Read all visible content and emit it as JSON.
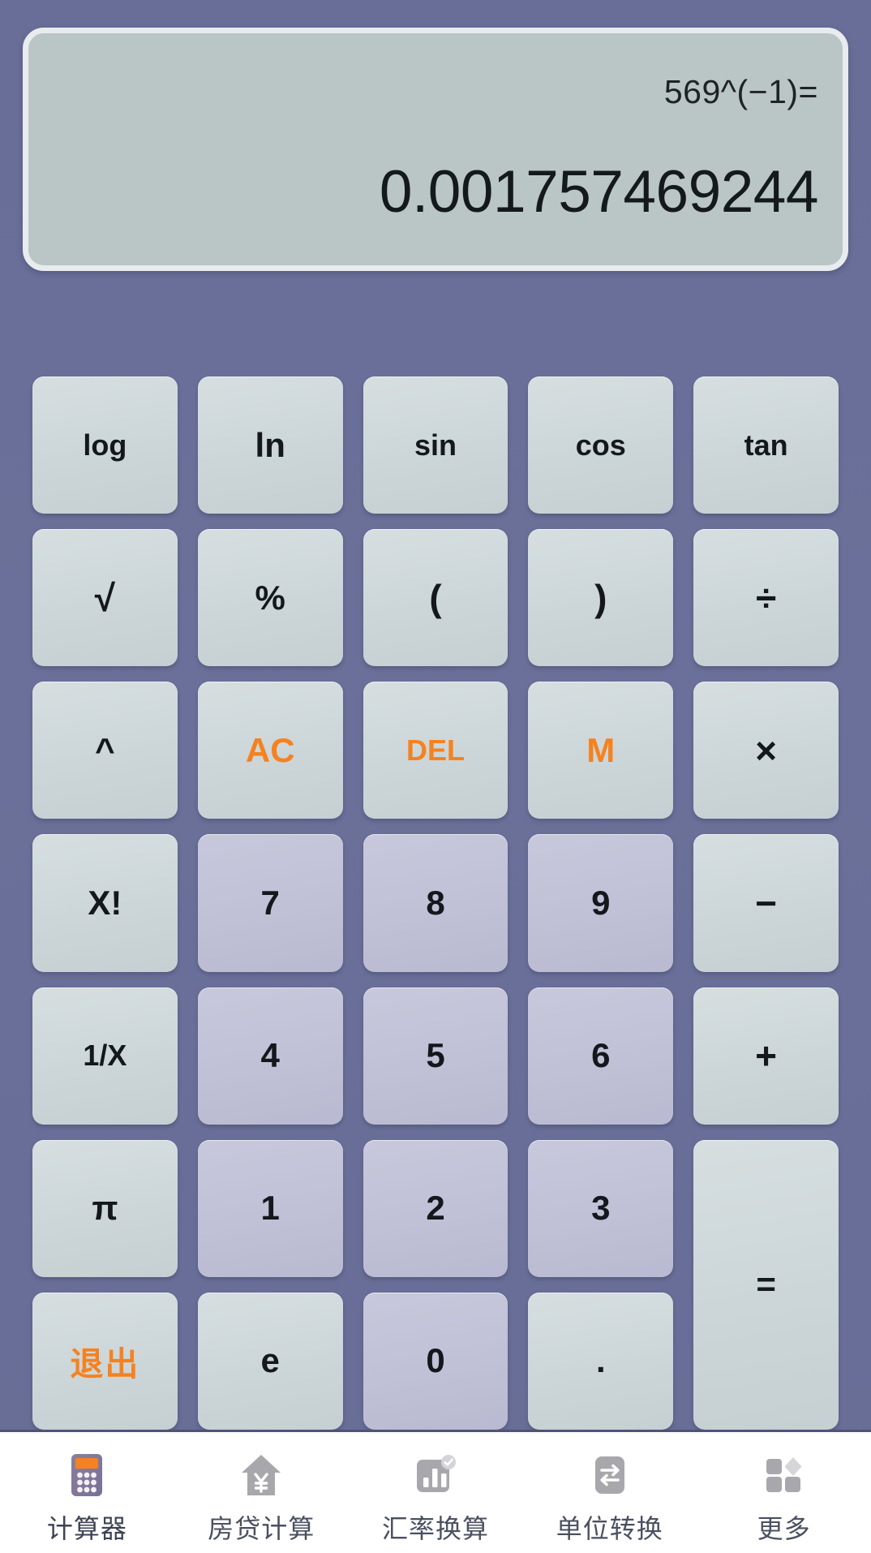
{
  "app": {
    "name": "计算器",
    "accent_color": "#f58220",
    "background_color": "#6a7099",
    "display_color": "#bac5c5",
    "key_color": "#ccd6d8",
    "digit_key_color": "#c0c0d6"
  },
  "display": {
    "expression": "569^(−1)=",
    "result": "0.001757469244"
  },
  "keypad": {
    "rows": [
      [
        {
          "label": "log",
          "kind": "func"
        },
        {
          "label": "ln",
          "kind": "func"
        },
        {
          "label": "sin",
          "kind": "func"
        },
        {
          "label": "cos",
          "kind": "func"
        },
        {
          "label": "tan",
          "kind": "func"
        }
      ],
      [
        {
          "label": "√",
          "kind": "func"
        },
        {
          "label": "%",
          "kind": "func"
        },
        {
          "label": "(",
          "kind": "func"
        },
        {
          "label": ")",
          "kind": "func"
        },
        {
          "label": "÷",
          "kind": "operator"
        }
      ],
      [
        {
          "label": "^",
          "kind": "func"
        },
        {
          "label": "AC",
          "kind": "accent"
        },
        {
          "label": "DEL",
          "kind": "accent"
        },
        {
          "label": "M",
          "kind": "accent"
        },
        {
          "label": "×",
          "kind": "operator"
        }
      ],
      [
        {
          "label": "X!",
          "kind": "func"
        },
        {
          "label": "7",
          "kind": "digit"
        },
        {
          "label": "8",
          "kind": "digit"
        },
        {
          "label": "9",
          "kind": "digit"
        },
        {
          "label": "−",
          "kind": "operator"
        }
      ],
      [
        {
          "label": "1/X",
          "kind": "func"
        },
        {
          "label": "4",
          "kind": "digit"
        },
        {
          "label": "5",
          "kind": "digit"
        },
        {
          "label": "6",
          "kind": "digit"
        },
        {
          "label": "+",
          "kind": "operator"
        }
      ],
      [
        {
          "label": "π",
          "kind": "func"
        },
        {
          "label": "1",
          "kind": "digit"
        },
        {
          "label": "2",
          "kind": "digit"
        },
        {
          "label": "3",
          "kind": "digit"
        },
        {
          "label": "=",
          "kind": "equals"
        }
      ],
      [
        {
          "label": "退出",
          "kind": "accent-cjk"
        },
        {
          "label": "e",
          "kind": "func"
        },
        {
          "label": "0",
          "kind": "digit"
        },
        {
          "label": ".",
          "kind": "func"
        }
      ]
    ]
  },
  "navbar": {
    "items": [
      {
        "label": "计算器",
        "icon": "calculator-icon",
        "active": true
      },
      {
        "label": "房贷计算",
        "icon": "house-yen-icon",
        "active": false
      },
      {
        "label": "汇率换算",
        "icon": "bar-chart-check-icon",
        "active": false
      },
      {
        "label": "单位转换",
        "icon": "swap-arrows-icon",
        "active": false
      },
      {
        "label": "更多",
        "icon": "grid-more-icon",
        "active": false
      }
    ]
  }
}
